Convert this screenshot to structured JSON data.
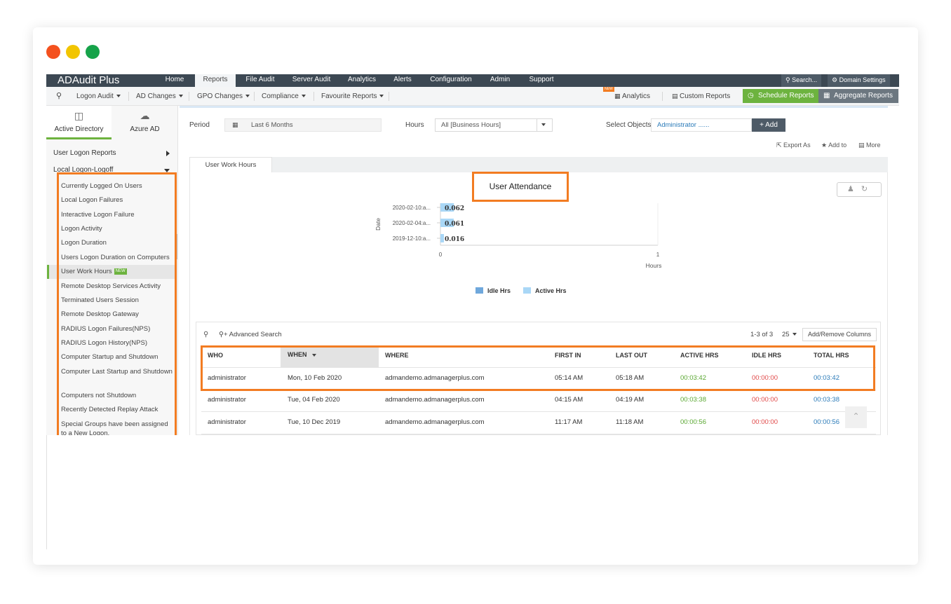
{
  "window": {
    "dots": [
      "#f4511e",
      "#f2c500",
      "#16a34a"
    ]
  },
  "topnav": {
    "brand": "ADAudit Plus",
    "tabs": [
      "Home",
      "Reports",
      "File Audit",
      "Server Audit",
      "Analytics",
      "Alerts",
      "Configuration",
      "Admin",
      "Support"
    ],
    "active_tab": "Reports",
    "search": "Search...",
    "domain_settings": "Domain Settings"
  },
  "subnav": {
    "menus": [
      "Logon Audit",
      "AD Changes",
      "GPO Changes",
      "Compliance",
      "Favourite Reports"
    ],
    "analytics": "Analytics",
    "analytics_badge": "NEW",
    "custom_reports": "Custom Reports",
    "schedule_reports": "Schedule Reports",
    "aggregate_reports": "Aggregate Reports"
  },
  "sidebar": {
    "dir_tabs": [
      "Active Directory",
      "Azure AD"
    ],
    "section1": "User Logon Reports",
    "section2": "Local Logon-Logoff",
    "items": [
      "Currently Logged On Users",
      "Local Logon Failures",
      "Interactive Logon Failure",
      "Logon Activity",
      "Logon Duration",
      "Users Logon Duration on Computers",
      "User Work Hours",
      "Remote Desktop Services Activity",
      "Terminated Users Session",
      "Remote Desktop Gateway",
      "RADIUS Logon Failures(NPS)",
      "RADIUS Logon History(NPS)",
      "Computer Startup and Shutdown",
      "Computer Last Startup and Shutdown",
      "Computers not Shutdown",
      "Recently Detected Replay Attack",
      "Special Groups have been assigned to a New Logon."
    ],
    "active_item": "User Work Hours",
    "new_badge": "NEW"
  },
  "filters": {
    "period_label": "Period",
    "period_value": "Last 6 Months",
    "hours_label": "Hours",
    "hours_value": "All [Business Hours]",
    "objects_label": "Select Objects",
    "objects_value": "Administrator ......",
    "add_button": "Add",
    "export_as": "Export As",
    "add_to": "Add to",
    "more": "More"
  },
  "report_tab": "User Work Hours",
  "chart_data": {
    "type": "bar",
    "title": "User Attendance",
    "categories": [
      "2020-02-10:a...",
      "2020-02-04:a...",
      "2019-12-10:a..."
    ],
    "series": [
      {
        "name": "Idle Hrs",
        "values": [
          0,
          0,
          0
        ],
        "color": "#6fa8dc"
      },
      {
        "name": "Active Hrs",
        "values": [
          0.062,
          0.061,
          0.016
        ],
        "color": "#a9d7f6"
      }
    ],
    "data_labels": [
      "0.062",
      "0.061",
      "0.016"
    ],
    "xlabel": "Hours",
    "ylabel": "Date",
    "x_ticks": [
      "0",
      "1"
    ],
    "xlim": [
      0,
      1
    ],
    "orientation": "horizontal",
    "legend_position": "bottom"
  },
  "table": {
    "search_label": "Advanced Search",
    "range": "1-3 of 3",
    "page_size": "25",
    "add_remove_columns": "Add/Remove Columns",
    "headers": [
      "WHO",
      "WHEN",
      "WHERE",
      "FIRST IN",
      "LAST OUT",
      "ACTIVE HRS",
      "IDLE HRS",
      "TOTAL HRS"
    ],
    "rows": [
      [
        "administrator",
        "Mon, 10 Feb 2020",
        "admandemo.admanagerplus.com",
        "05:14 AM",
        "05:18 AM",
        "00:03:42",
        "00:00:00",
        "00:03:42"
      ],
      [
        "administrator",
        "Tue, 04 Feb 2020",
        "admandemo.admanagerplus.com",
        "04:15 AM",
        "04:19 AM",
        "00:03:38",
        "00:00:00",
        "00:03:38"
      ],
      [
        "administrator",
        "Tue, 10 Dec 2019",
        "admandemo.admanagerplus.com",
        "11:17 AM",
        "11:18 AM",
        "00:00:56",
        "00:00:00",
        "00:00:56"
      ]
    ],
    "colors": {
      "active": "#5aa832",
      "idle": "#e04848",
      "total": "#2b7bb9"
    }
  }
}
